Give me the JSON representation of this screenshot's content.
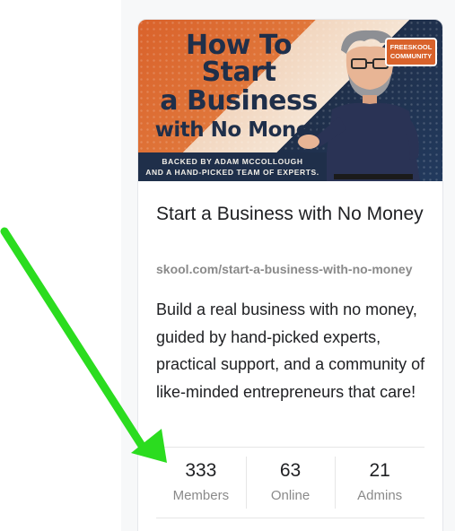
{
  "banner": {
    "title_line1": "How To Start",
    "title_line2": "a Business",
    "title_line3": "with No Money",
    "badge_line1": "FREESKOOL",
    "badge_line2": "COMMUNITY",
    "strip_line1": "BACKED BY ADAM MCCOLLOUGH",
    "strip_line2": "AND A HAND-PICKED TEAM OF EXPERTS."
  },
  "card": {
    "title": "Start a Business with No Money",
    "url": "skool.com/start-a-business-with-no-money",
    "description": "Build a real business with no money, guided by hand-picked experts, practical support, and a community of like-minded entrepreneurs that care!"
  },
  "stats": [
    {
      "value": "333",
      "label": "Members"
    },
    {
      "value": "63",
      "label": "Online"
    },
    {
      "value": "21",
      "label": "Admins"
    }
  ],
  "colors": {
    "arrow": "#2bdc1f",
    "banner_orange": "#d9622b",
    "banner_navy": "#1f2f4a"
  }
}
